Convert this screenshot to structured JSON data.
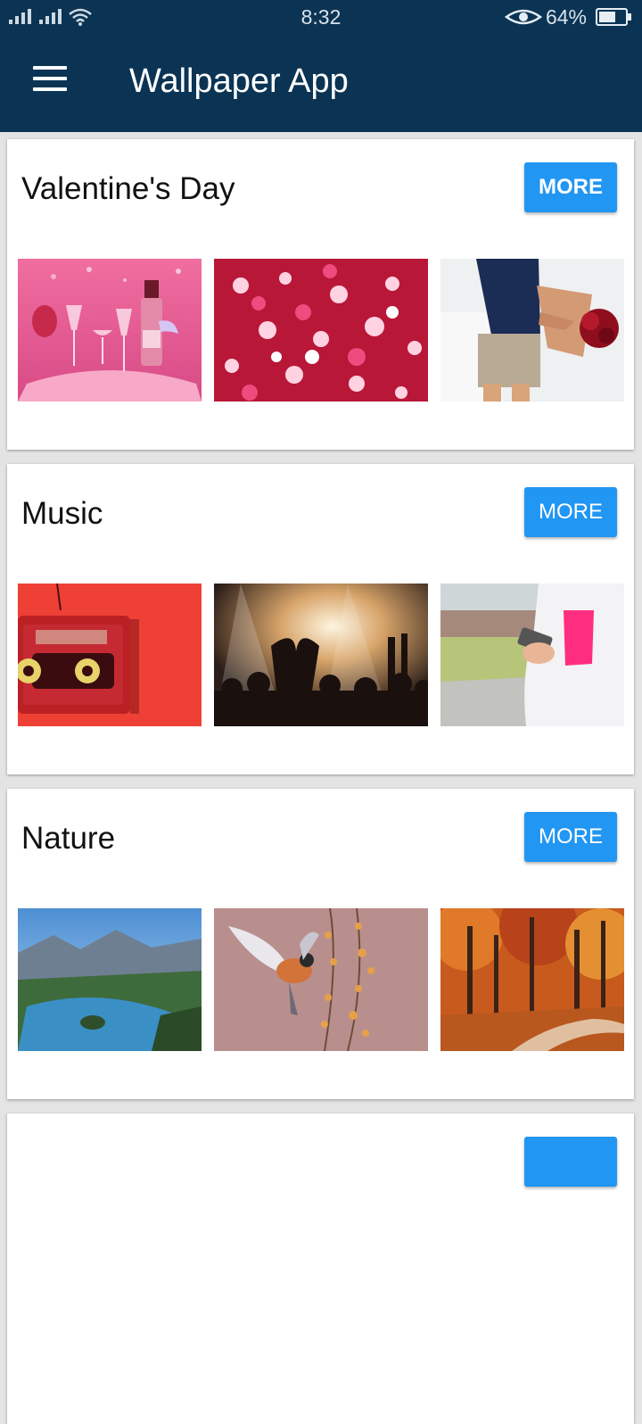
{
  "status_bar": {
    "time": "8:32",
    "battery_percent": "64%",
    "battery_level": 0.64,
    "icons": [
      "signal-icon",
      "signal-icon",
      "wifi-icon",
      "eye-icon",
      "battery-icon"
    ]
  },
  "app_bar": {
    "title": "Wallpaper App",
    "menu_icon": "hamburger-menu-icon"
  },
  "categories": [
    {
      "title": "Valentine's Day",
      "more_label": "MORE",
      "thumbnails": [
        "champagne-glasses-image",
        "heart-candies-image",
        "couple-roses-image"
      ]
    },
    {
      "title": "Music",
      "more_label": "MORE",
      "thumbnails": [
        "cassette-tape-image",
        "concert-crowd-image",
        "jogger-phone-image"
      ]
    },
    {
      "title": "Nature",
      "more_label": "MORE",
      "thumbnails": [
        "mountain-lake-image",
        "bird-flight-image",
        "autumn-forest-image"
      ]
    }
  ],
  "colors": {
    "app_bar": "#0b3454",
    "accent": "#2196f3",
    "background": "#e4e4e4"
  }
}
